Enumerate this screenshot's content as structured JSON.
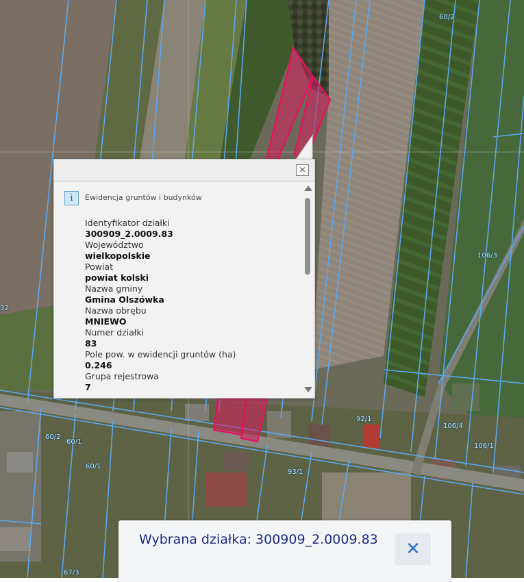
{
  "map": {
    "parcel_labels": [
      "60/2",
      "106/3",
      "37",
      "60/2",
      "60/1",
      "92/1",
      "106/4",
      "106/1",
      "60/1",
      "93/1",
      "67/3"
    ]
  },
  "popup": {
    "layer_name": "Ewidencja gruntów i budynków",
    "info_icon": "info-icon",
    "close_icon": "close-icon",
    "attributes": [
      {
        "label": "Identyfikator działki",
        "value": "300909_2.0009.83"
      },
      {
        "label": "Województwo",
        "value": "wielkopolskie"
      },
      {
        "label": "Powiat",
        "value": "powiat kolski"
      },
      {
        "label": "Nazwa gminy",
        "value": "Gmina Olszówka"
      },
      {
        "label": "Nazwa obrębu",
        "value": "MNIEWO"
      },
      {
        "label": "Numer działki",
        "value": "83"
      },
      {
        "label": "Pole pow. w ewidencji gruntów (ha)",
        "value": "0.246"
      },
      {
        "label": "Grupa rejestrowa",
        "value": "7"
      }
    ]
  },
  "selection_bar": {
    "text": "Wybrana działka: 300909_2.0009.83",
    "close_symbol": "✕"
  },
  "colors": {
    "parcel_line": "#5aa9f0",
    "selected_fill": "#d81e63",
    "selection_text": "#1b2a83",
    "close_button": "#2e74c9"
  }
}
